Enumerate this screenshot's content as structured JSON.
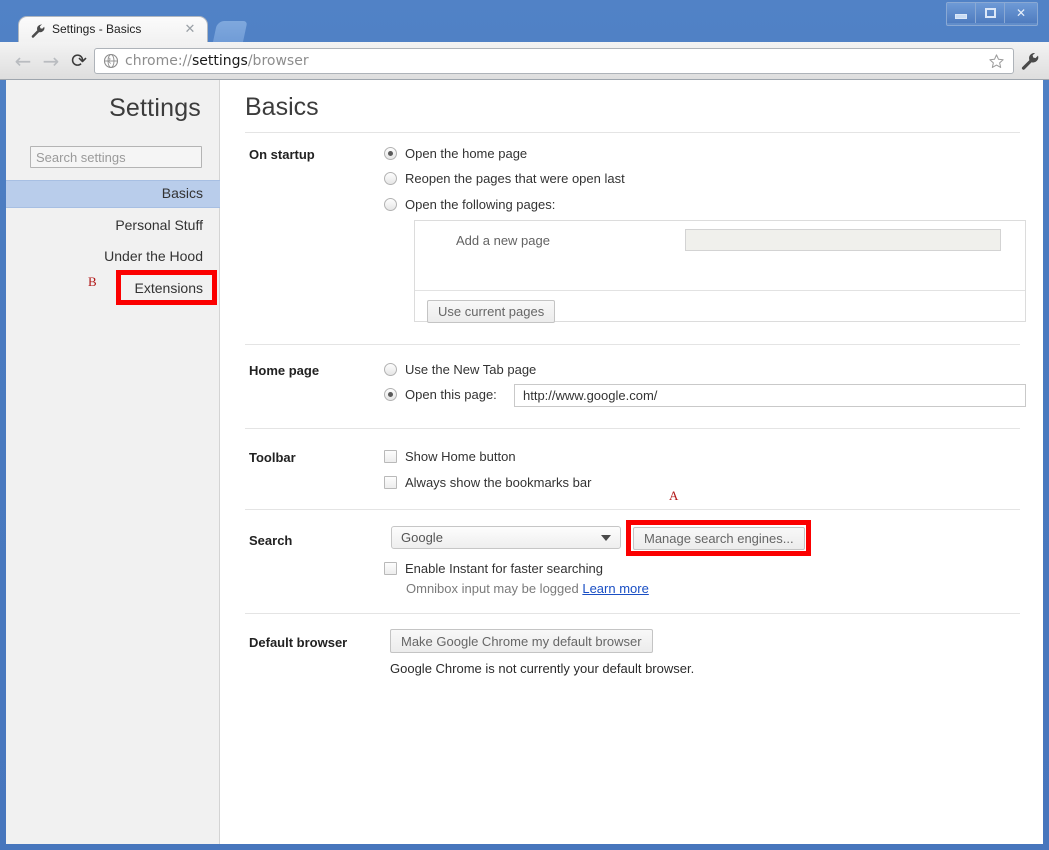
{
  "window": {
    "controls": [
      {
        "name": "minimize",
        "glyph": "minimize-icon"
      },
      {
        "name": "maximize",
        "glyph": "maximize-icon"
      },
      {
        "name": "close",
        "glyph": "close-icon",
        "label": "✕"
      }
    ]
  },
  "tab": {
    "title": "Settings - Basics",
    "favicon": "wrench-icon",
    "close_label": "✕",
    "newtab_label": "+"
  },
  "toolbar": {
    "back": "←",
    "forward": "→",
    "reload": "⟳",
    "omnibox": {
      "prefix": "chrome://",
      "emphasis": "settings",
      "suffix": "/browser",
      "full": "chrome://settings/browser",
      "site_icon": "globe-icon"
    },
    "star": "bookmark-star-icon",
    "wrench": "wrench-menu-icon"
  },
  "sidebar": {
    "title": "Settings",
    "search_placeholder": "Search settings",
    "search_value": "",
    "items": [
      {
        "label": "Basics",
        "selected": true
      },
      {
        "label": "Personal Stuff",
        "selected": false
      },
      {
        "label": "Under the Hood",
        "selected": false
      },
      {
        "label": "Extensions",
        "selected": false,
        "annotation": "B"
      }
    ]
  },
  "annotations": [
    {
      "id": "A",
      "target": "Manage search engines...",
      "color": "#b11616",
      "box_color": "#fb0000"
    },
    {
      "id": "B",
      "target": "Extensions",
      "color": "#b11616",
      "box_color": "#fb0000"
    }
  ],
  "content": {
    "heading": "Basics",
    "sections": {
      "on_startup": {
        "label": "On startup",
        "options": [
          {
            "label": "Open the home page",
            "selected": true
          },
          {
            "label": "Reopen the pages that were open last",
            "selected": false
          },
          {
            "label": "Open the following pages:",
            "selected": false
          }
        ],
        "add_page_label": "Add a new page",
        "add_page_value": "",
        "use_current_pages_button": "Use current pages"
      },
      "home_page": {
        "label": "Home page",
        "options": [
          {
            "label": "Use the New Tab page",
            "selected": false
          },
          {
            "label": "Open this page:",
            "selected": true
          }
        ],
        "url_value": "http://www.google.com/"
      },
      "toolbar": {
        "label": "Toolbar",
        "checkboxes": [
          {
            "label": "Show Home button",
            "checked": false
          },
          {
            "label": "Always show the bookmarks bar",
            "checked": false
          }
        ]
      },
      "search": {
        "label": "Search",
        "engine_selected": "Google",
        "manage_button": "Manage search engines...",
        "instant_checkbox": {
          "label": "Enable Instant for faster searching",
          "checked": false
        },
        "instant_note": "Omnibox input may be logged",
        "instant_link": "Learn more"
      },
      "default_browser": {
        "label": "Default browser",
        "button": "Make Google Chrome my default browser",
        "status": "Google Chrome is not currently your default browser."
      }
    }
  }
}
